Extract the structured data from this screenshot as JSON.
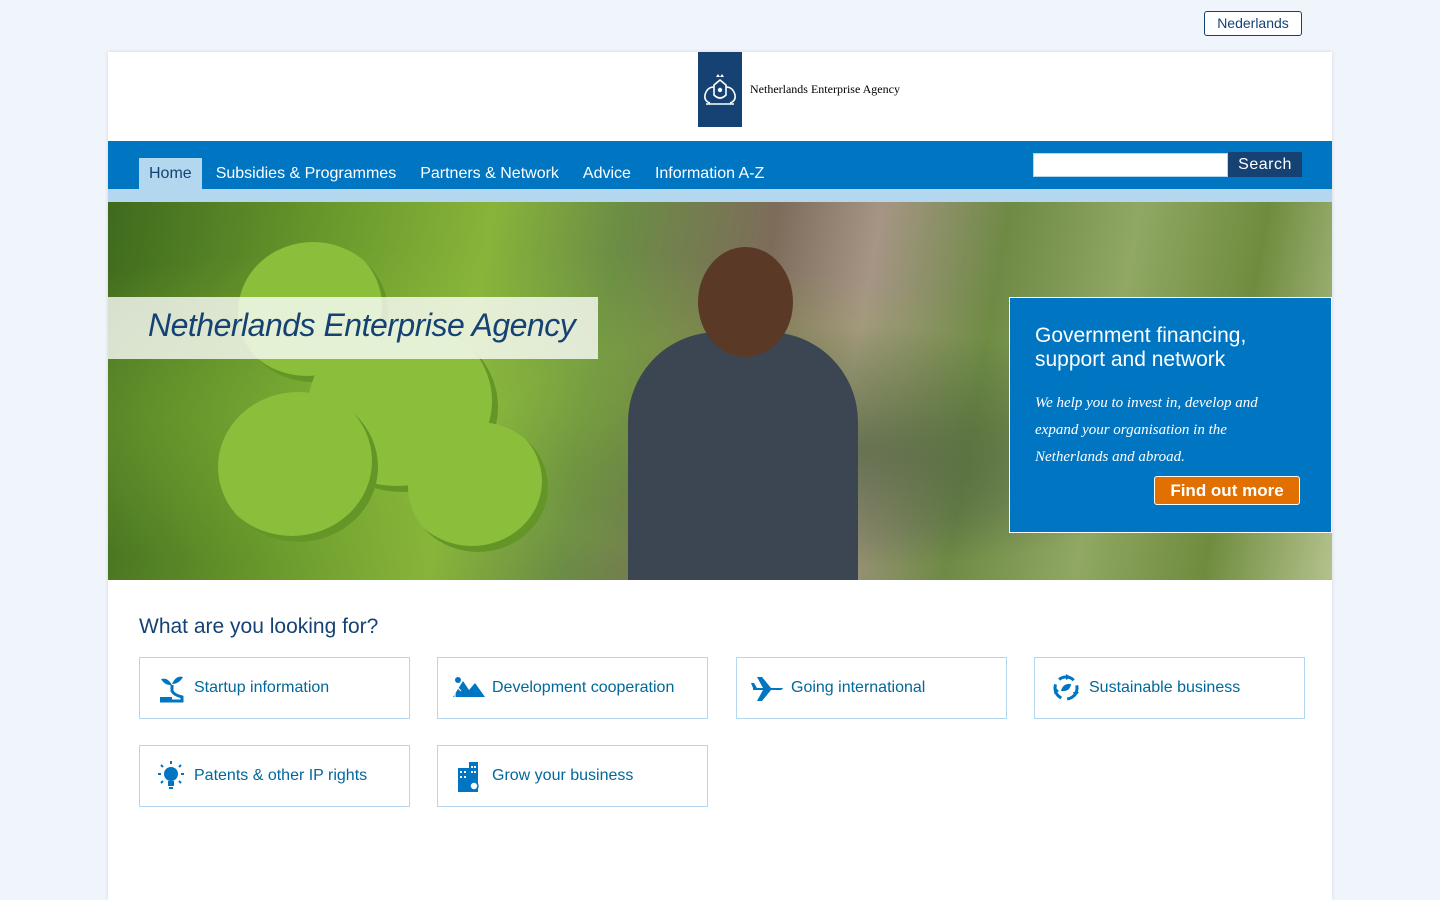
{
  "top": {
    "language_button": "Nederlands"
  },
  "header": {
    "logo_text": "Netherlands Enterprise Agency"
  },
  "nav": {
    "items": [
      {
        "label": "Home",
        "active": true
      },
      {
        "label": "Subsidies & Programmes"
      },
      {
        "label": "Partners & Network"
      },
      {
        "label": "Advice"
      },
      {
        "label": "Information A-Z"
      }
    ],
    "search": {
      "value": "",
      "button_label": "Search"
    }
  },
  "hero": {
    "title": "Netherlands Enterprise Agency",
    "promo": {
      "title": "Government financing, support and network",
      "text": "We help you to invest in, develop and expand your organisation in the Netherlands and abroad.",
      "button_label": "Find out more"
    }
  },
  "topics": {
    "heading": "What are you looking for?",
    "tiles": [
      {
        "label": "Startup information",
        "icon": "sprout-icon"
      },
      {
        "label": "Development cooperation",
        "icon": "mountains-icon"
      },
      {
        "label": "Going international",
        "icon": "airplane-icon"
      },
      {
        "label": "Sustainable business",
        "icon": "recycle-icon"
      },
      {
        "label": "Patents & other IP rights",
        "icon": "lightbulb-icon"
      },
      {
        "label": "Grow your business",
        "icon": "buildings-icon"
      }
    ]
  },
  "colors": {
    "brand_dark_blue": "#154273",
    "nav_blue": "#0075c2",
    "light_blue": "#b2d7ee",
    "accent_orange": "#e17000",
    "link_blue": "#01689b"
  }
}
